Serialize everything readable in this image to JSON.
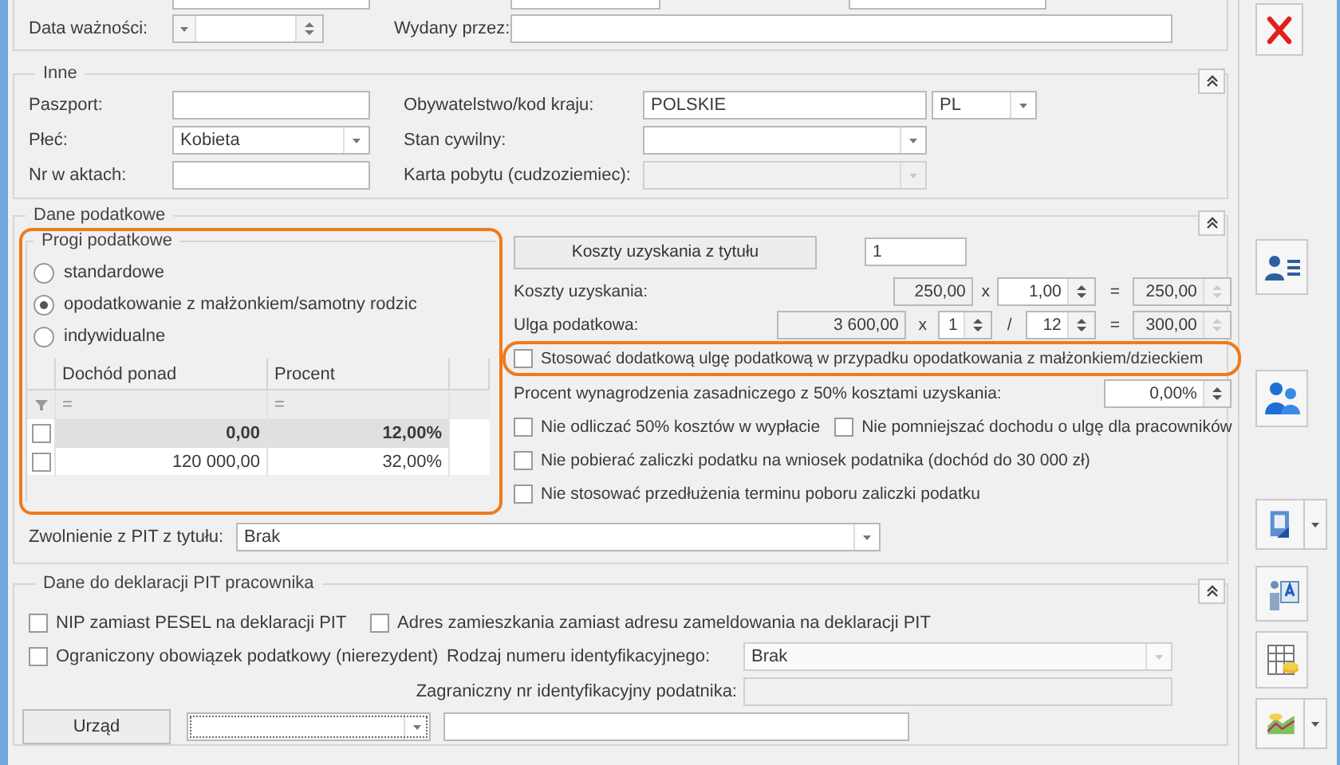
{
  "top_section": {
    "expiry_date": {
      "label": "Data ważności:"
    },
    "issued_by": {
      "label": "Wydany przez:"
    }
  },
  "other": {
    "title": "Inne",
    "passport": {
      "label": "Paszport:"
    },
    "gender": {
      "label": "Płeć:",
      "value": "Kobieta"
    },
    "file_number": {
      "label": "Nr w aktach:"
    },
    "citizenship": {
      "label": "Obywatelstwo/kod kraju:",
      "value": "POLSKIE",
      "code": "PL"
    },
    "marital_status": {
      "label": "Stan cywilny:"
    },
    "residence_card": {
      "label": "Karta pobytu (cudzoziemiec):",
      "disabled": true
    }
  },
  "tax_data": {
    "title": "Dane podatkowe",
    "thresholds": {
      "title": "Progi podatkowe",
      "highlighted": true,
      "options": [
        {
          "label": "standardowe",
          "selected": false
        },
        {
          "label": "opodatkowanie z małżonkiem/samotny rodzic",
          "selected": true
        },
        {
          "label": "indywidualne",
          "selected": false
        }
      ],
      "table": {
        "columns": [
          "Dochód ponad",
          "Procent"
        ],
        "filter_row": [
          "=",
          "="
        ],
        "rows": [
          {
            "checked": false,
            "selected": true,
            "cells": [
              "0,00",
              "12,00%"
            ]
          },
          {
            "checked": false,
            "selected": false,
            "cells": [
              "120 000,00",
              "32,00%"
            ]
          }
        ]
      }
    },
    "cost_button": "Koszty uzyskania z tytułu",
    "cost_count": "1",
    "costs": {
      "label": "Koszty uzyskania:",
      "base": "250,00",
      "times": "x",
      "multiplier": "1,00",
      "equals": "=",
      "result": "250,00"
    },
    "relief": {
      "label": "Ulga podatkowa:",
      "base": "3 600,00",
      "times": "x",
      "numerator": "1",
      "divide": "/",
      "denominator": "12",
      "equals": "=",
      "result": "300,00"
    },
    "joint_relief": {
      "label": "Stosować dodatkową ulgę podatkową w przypadku opodatkowania z małżonkiem/dzieckiem",
      "checked": false,
      "highlighted": true
    },
    "salary_percent": {
      "label": "Procent wynagrodzenia zasadniczego z 50% kosztami uzyskania:",
      "value": "0,00%"
    },
    "option_rows": [
      {
        "items": [
          {
            "label": "Nie odliczać 50% kosztów w wypłacie",
            "checked": false
          },
          {
            "label": "Nie pomniejszać dochodu o ulgę dla pracowników",
            "checked": false
          }
        ]
      },
      {
        "items": [
          {
            "label": "Nie pobierać zaliczki podatku na wniosek podatnika (dochód do 30 000 zł)",
            "checked": false
          }
        ]
      },
      {
        "items": [
          {
            "label": "Nie stosować przedłużenia terminu poboru zaliczki podatku",
            "checked": false
          }
        ]
      }
    ],
    "exemption": {
      "label": "Zwolnienie z PIT z tytułu:",
      "value": "Brak"
    }
  },
  "pit": {
    "title": "Dane do deklaracji PIT pracownika",
    "nip_instead_pesel": {
      "label": "NIP zamiast PESEL na deklaracji PIT",
      "checked": false
    },
    "residence_address": {
      "label": "Adres zamieszkania zamiast adresu zameldowania na deklaracji PIT",
      "checked": false
    },
    "non_resident": {
      "label": "Ograniczony obowiązek podatkowy (nierezydent)",
      "checked": false
    },
    "id_type": {
      "label": "Rodzaj numeru identyfikacyjnego:",
      "value": "Brak",
      "disabled": true
    },
    "foreign_id": {
      "label": "Zagraniczny nr identyfikacyjny podatnika:",
      "disabled": true
    },
    "office_button": "Urząd"
  }
}
